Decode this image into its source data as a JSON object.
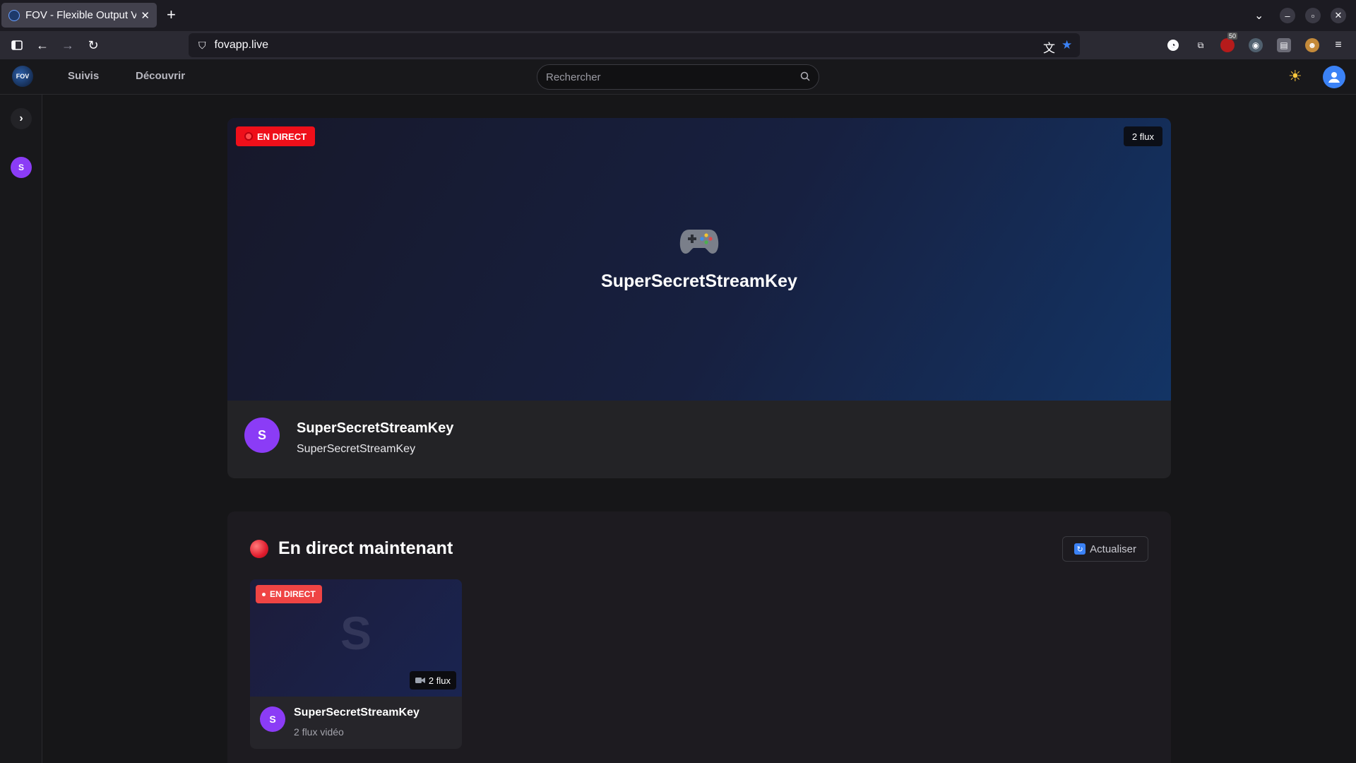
{
  "browser": {
    "tab_title": "FOV - Flexible Output Vi",
    "new_tab": "+",
    "url": "fovapp.live",
    "tab_list_icon": "⌄",
    "window_controls": {
      "minimize": "–",
      "maximize": "▫",
      "close": "✕"
    },
    "extension_badge": "50"
  },
  "header": {
    "logo_text": "FOV",
    "nav": {
      "following": "Suivis",
      "discover": "Découvrir"
    },
    "search_placeholder": "Rechercher",
    "theme_icon": "☀"
  },
  "sidebar": {
    "expand_icon": "›",
    "channels": [
      {
        "initial": "S"
      }
    ]
  },
  "hero": {
    "live_label": "EN DIRECT",
    "flux_count": "2 flux",
    "title": "SuperSecretStreamKey",
    "channel_initial": "S",
    "channel_name": "SuperSecretStreamKey",
    "channel_subtitle": "SuperSecretStreamKey"
  },
  "live_now": {
    "title": "En direct maintenant",
    "refresh_label": "Actualiser",
    "refresh_icon": "↻",
    "cards": [
      {
        "live_label": "EN DIRECT",
        "thumb_letter": "S",
        "flux_label": "2 flux",
        "initial": "S",
        "name": "SuperSecretStreamKey",
        "subtitle": "2 flux vidéo"
      }
    ]
  },
  "colors": {
    "live_red": "#ef0f1a",
    "avatar_purple": "#8b3cf6",
    "accent_blue": "#3b82f6"
  }
}
